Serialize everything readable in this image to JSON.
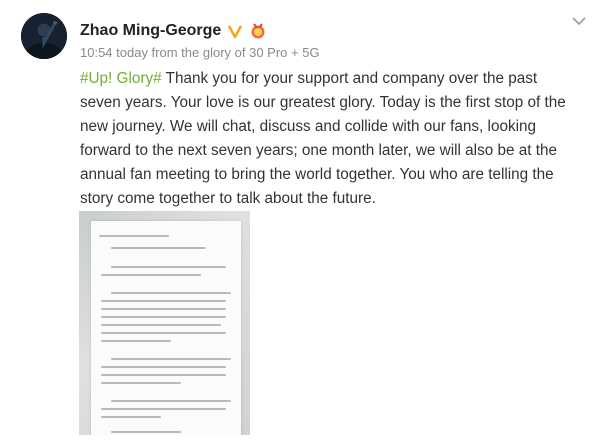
{
  "post": {
    "author": "Zhao Ming-George",
    "meta": "10:54 today from the glory of 30 Pro + 5G",
    "hashtag": "#Up! Glory#",
    "body": " Thank you for your support and company over the past seven years. Your love is our greatest glory. Today is the first stop of the new journey. We will chat, discuss and collide with our fans, looking forward to the next seven years; one month later, we will also be at the annual fan meeting to bring the world together. You who are telling the story come together to talk about the future."
  },
  "colors": {
    "hashtag": "#6fb035",
    "verified_badge": "#f5a623",
    "meta_text": "#8a8a8a"
  },
  "icons": {
    "verified": "verified-badge-icon",
    "medal": "medal-icon",
    "menu": "chevron-down-icon"
  }
}
